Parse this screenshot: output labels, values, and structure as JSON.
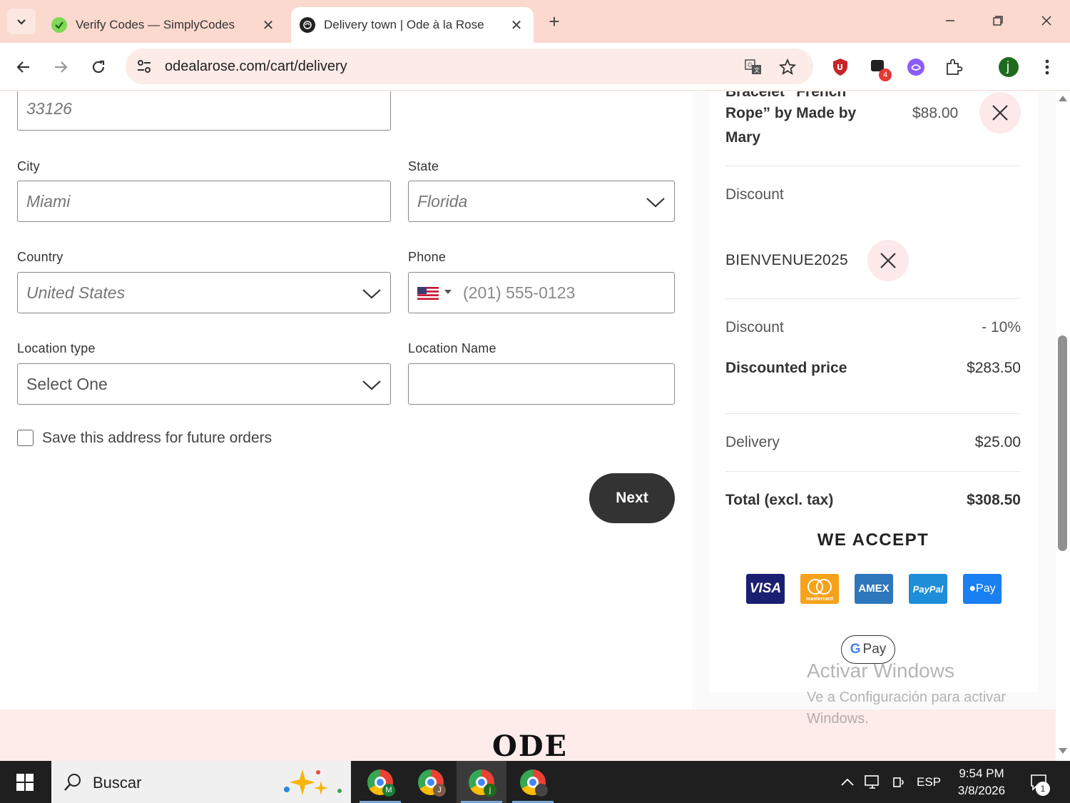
{
  "browser": {
    "tabs": [
      {
        "title": "Verify Codes — SimplyCodes",
        "active": false
      },
      {
        "title": "Delivery town | Ode à la Rose",
        "active": true
      }
    ],
    "url": "odealarose.com/cart/delivery",
    "extension_badge": "4",
    "profile_initial": "j"
  },
  "form": {
    "zip_value": "33126",
    "city_label": "City",
    "city_value": "Miami",
    "state_label": "State",
    "state_value": "Florida",
    "country_label": "Country",
    "country_value": "United States",
    "phone_label": "Phone",
    "phone_placeholder": "(201) 555-0123",
    "location_type_label": "Location type",
    "location_type_value": "Select One",
    "location_name_label": "Location Name",
    "location_name_value": "",
    "save_address_label": "Save this address for future orders",
    "next_label": "Next"
  },
  "summary": {
    "item_name_line1": "Bracelet “French",
    "item_name_line2": "Rope” by Made by",
    "item_name_line3": "Mary",
    "item_price": "$88.00",
    "discount_heading": "Discount",
    "discount_code": "BIENVENUE2025",
    "discount_label": "Discount",
    "discount_value": "- 10%",
    "discounted_price_label": "Discounted price",
    "discounted_price_value": "$283.50",
    "delivery_label": "Delivery",
    "delivery_value": "$25.00",
    "total_label": "Total (excl. tax)",
    "total_value": "$308.50",
    "we_accept": "WE ACCEPT",
    "cards": [
      "VISA",
      "mastercard",
      "AMEX",
      "PayPal",
      "Pay"
    ],
    "gpay": "Pay"
  },
  "watermark": {
    "line1": "Activar Windows",
    "line2": "Ve a Configuración para activar Windows."
  },
  "footer": {
    "logo": "ODE"
  },
  "taskbar": {
    "search": "Buscar",
    "apps": [
      {
        "badge": "M"
      },
      {
        "badge": "J"
      },
      {
        "badge": "j"
      },
      {
        "badge": ""
      }
    ],
    "language": "ESP",
    "time": "9:54 PM",
    "date": "3/8/2026",
    "notification_count": "1"
  },
  "colors": {
    "tabbar": "#fbd9cf",
    "next_button": "#333333",
    "x_circle": "#fde8ea",
    "footer": "#fdecea"
  }
}
